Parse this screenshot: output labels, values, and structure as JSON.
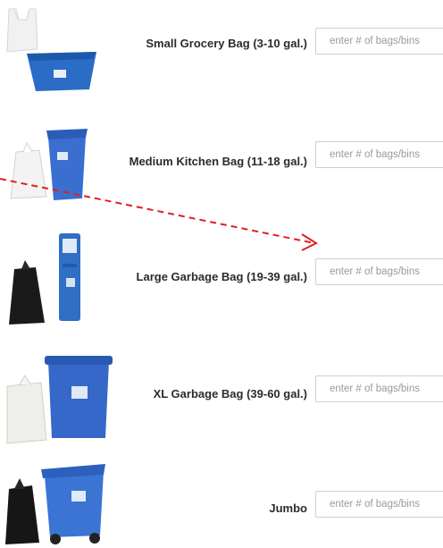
{
  "items": [
    {
      "label": "Small Grocery Bag (3-10 gal.)",
      "value": "",
      "placeholder": "enter # of bags/bins",
      "icons": [
        "plastic-bag-icon",
        "recycling-tub-icon"
      ]
    },
    {
      "label": "Medium Kitchen Bag (11-18 gal.)",
      "value": "",
      "placeholder": "enter # of bags/bins",
      "icons": [
        "white-trash-bag-icon",
        "kitchen-bin-icon"
      ]
    },
    {
      "label": "Large Garbage Bag (19-39 gal.)",
      "value": "",
      "placeholder": "enter # of bags/bins",
      "icons": [
        "black-garbage-bag-icon",
        "tall-recycling-bin-icon"
      ]
    },
    {
      "label": "XL Garbage Bag (39-60 gal.)",
      "value": "",
      "placeholder": "enter # of bags/bins",
      "icons": [
        "clear-garbage-bag-icon",
        "round-trash-can-icon"
      ]
    },
    {
      "label": "Jumbo",
      "value": "",
      "placeholder": "enter # of bags/bins",
      "icons": [
        "black-garbage-bag-icon",
        "wheeled-cart-icon"
      ]
    }
  ],
  "colors": {
    "bin_blue": "#2f6fc4",
    "arrow_red": "#e02020",
    "label": "#2b2b2b",
    "placeholder": "#9a9a9a",
    "border": "#cfcfcf"
  }
}
